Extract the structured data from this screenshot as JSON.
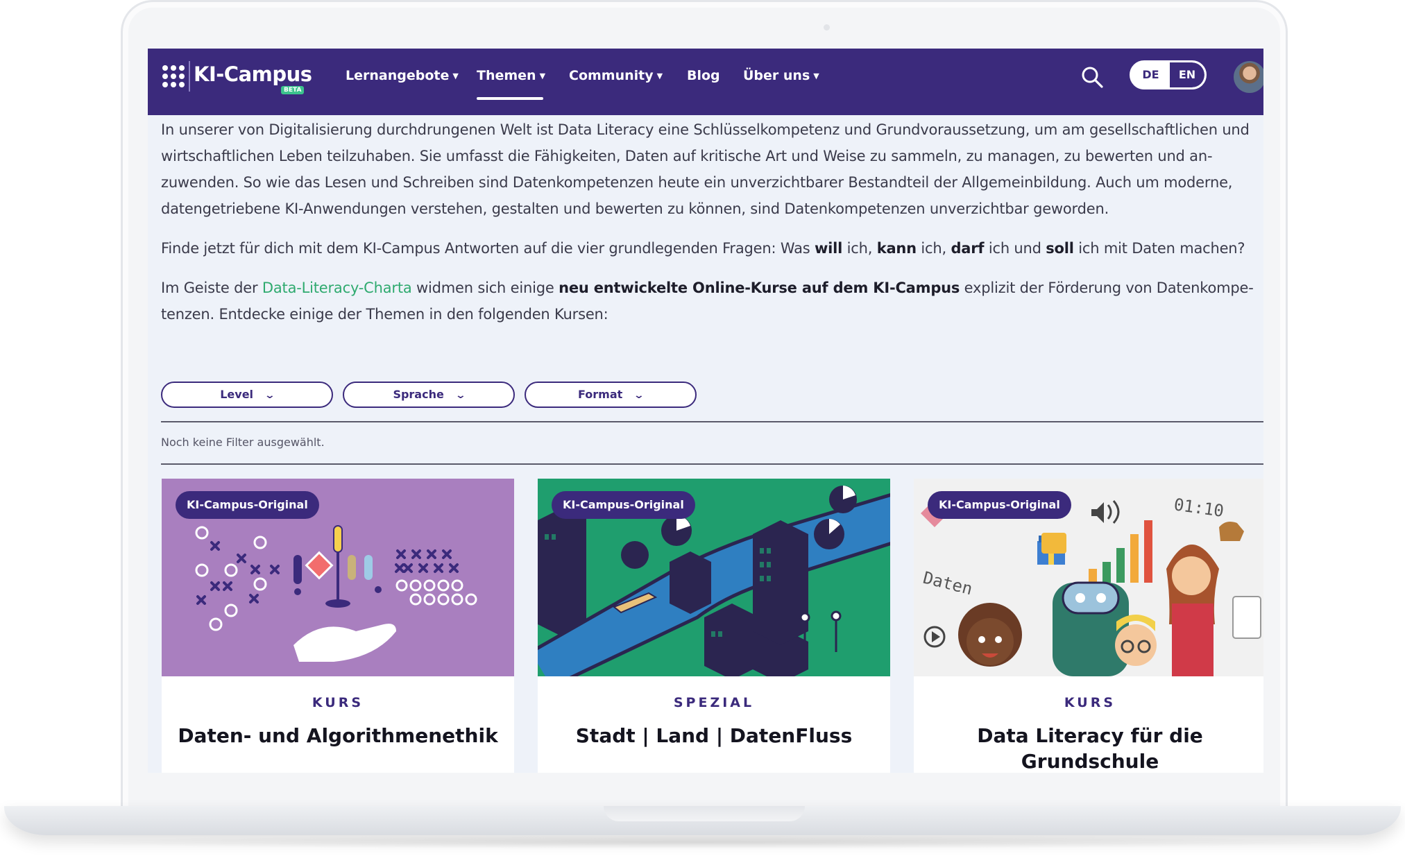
{
  "header": {
    "logo_text": "KI-Campus",
    "beta": "BETA",
    "nav": [
      {
        "label": "Lernangebote"
      },
      {
        "label": "Themen"
      },
      {
        "label": "Community"
      },
      {
        "label": "Blog"
      },
      {
        "label": "Über uns"
      }
    ],
    "lang_de": "DE",
    "lang_en": "EN",
    "accent": "#3b2a7c"
  },
  "content": {
    "p1": "In unserer von Digitalisierung durchdrungenen Welt ist Data Literacy eine Schlüsselkompetenz und Grundvoraussetzung, um am gesellschaftlichen und wirtschaftlichen Leben teilzuhaben. Sie umfasst die Fähigkeiten, Daten auf kritische Art und Weise zu sammeln, zu managen, zu bewerten und an-zuwenden. So wie das Lesen und Schreiben sind Datenkompetenzen heute ein unverzichtbarer Bestandteil der Allgemeinbildung. Auch um moderne, datengetriebene KI-Anwendungen verstehen, gestalten und bewerten zu können, sind Datenkompetenzen unverzichtbar geworden.",
    "p2_a": "Finde jetzt für dich mit dem KI-Campus Antworten auf die vier grundlegenden Fragen: Was ",
    "p2_will": "will",
    "p2_b": " ich, ",
    "p2_kann": "kann",
    "p2_c": " ich, ",
    "p2_darf": "darf",
    "p2_d": " ich und ",
    "p2_soll": "soll",
    "p2_e": " ich mit Daten machen?",
    "p3_a": "Im Geiste der ",
    "p3_link": "Data-Literacy-Charta",
    "p3_b": " widmen sich einige ",
    "p3_bold": "neu entwickelte Online-Kurse auf dem KI-Campus",
    "p3_c": " explizit der Förderung von Datenkompe-tenzen. Entdecke einige der Themen in den folgenden Kursen:"
  },
  "filters": {
    "level": "Level",
    "sprache": "Sprache",
    "format": "Format",
    "none_selected": "Noch keine Filter ausgewählt."
  },
  "cards": [
    {
      "badge": "KI-Campus-Original",
      "kind": "KURS",
      "title": "Daten- und Algorithmenethik",
      "color": "#a97fbf"
    },
    {
      "badge": "KI-Campus-Original",
      "kind": "SPEZIAL",
      "title": "Stadt | Land | DatenFluss",
      "color": "#1f9e6e"
    },
    {
      "badge": "KI-Campus-Original",
      "kind": "KURS",
      "title": "Data Literacy für die Grundschule",
      "color": "#f1f1f1"
    }
  ],
  "icons": {
    "search": "search-icon",
    "grid": "app-grid-icon",
    "chevron": "chevron-down-icon"
  }
}
